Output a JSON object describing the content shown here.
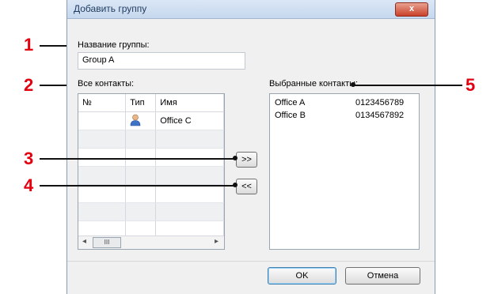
{
  "dialog": {
    "title": "Добавить группу",
    "close_label": "x"
  },
  "group_name": {
    "label": "Название группы:",
    "value": "Group A"
  },
  "all_contacts": {
    "label": "Все контакты:",
    "columns": [
      "№",
      "Тип",
      "Имя"
    ],
    "rows": [
      {
        "num": "",
        "type_icon": "person-icon",
        "name": "Office C"
      }
    ]
  },
  "selected_contacts": {
    "label": "Выбранные контакты:",
    "items": [
      {
        "name": "Office A",
        "number": "0123456789"
      },
      {
        "name": "Office B",
        "number": "0134567892"
      }
    ]
  },
  "buttons": {
    "add": ">>",
    "remove": "<<",
    "ok": "OK",
    "cancel": "Отмена"
  },
  "scrollbar": {
    "left": "◂",
    "thumb": "III",
    "right": "▸"
  },
  "callouts": [
    "1",
    "2",
    "3",
    "4",
    "5"
  ],
  "colors": {
    "callout_number": "#e3000f",
    "close_button": "#c9412a"
  }
}
